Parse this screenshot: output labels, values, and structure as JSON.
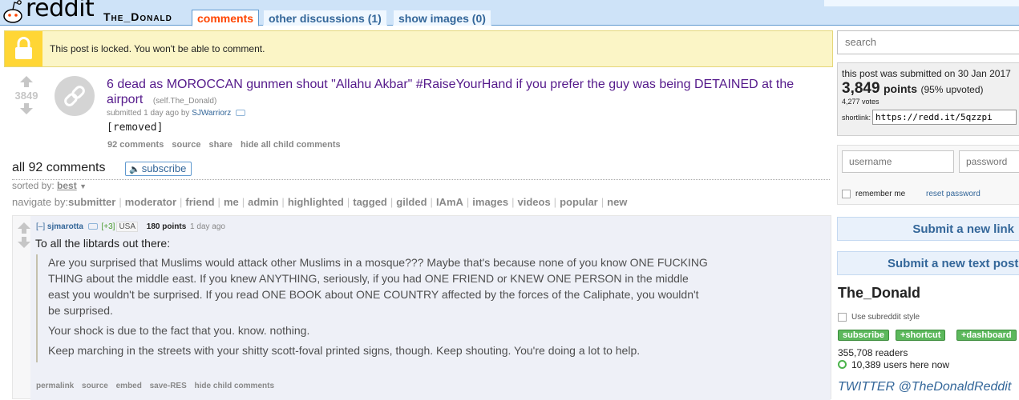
{
  "header": {
    "logo_text": "reddit",
    "subreddit": "The_Donald",
    "tabs": [
      {
        "label": "comments"
      },
      {
        "label": "other discussions (1)"
      },
      {
        "label": "show images (0)"
      }
    ]
  },
  "locked_banner": {
    "text": "This post is locked. You won't be able to comment."
  },
  "post": {
    "score": "3849",
    "title": "6 dead as MOROCCAN gunmen shout \"Allahu Akbar\" #RaiseYourHand if you prefer the guy was being DETAINED at the airport",
    "domain": "(self.The_Donald)",
    "tagline_prefix": "submitted 1 day ago by",
    "author": "SJWarriorz",
    "body": "[removed]",
    "buttons": [
      "92 comments",
      "source",
      "share",
      "hide all child comments"
    ]
  },
  "comments_header": {
    "all_comments": "all 92 comments",
    "subscribe": "subscribe",
    "sorted_by_label": "sorted by:",
    "sorted_by_value": "best",
    "navigate_label": "navigate by:",
    "navigate_items": [
      "submitter",
      "moderator",
      "friend",
      "me",
      "admin",
      "highlighted",
      "tagged",
      "gilded",
      "IAmA",
      "images",
      "videos",
      "popular",
      "new"
    ]
  },
  "comment": {
    "expand": "[–]",
    "author": "sjmarotta",
    "flair_score": "[+3]",
    "flair": "USA",
    "points": "180 points",
    "time": "1 day ago",
    "intro": "To all the libtards out there:",
    "quote_paragraphs": [
      "Are you surprised that Muslims would attack other Muslims in a mosque??? Maybe that's because none of you know ONE FUCKING THING about the middle east. If you knew ANYTHING, seriously, if you had ONE FRIEND or KNEW ONE PERSON in the middle east you wouldn't be surprised. If you read ONE BOOK about ONE COUNTRY affected by the forces of the Caliphate, you wouldn't be surprised.",
      "Your shock is due to the fact that you. know. nothing.",
      "Keep marching in the streets with your shitty scott-foval printed signs, though. Keep shouting. You're doing a lot to help."
    ],
    "buttons": [
      "permalink",
      "source",
      "embed",
      "save-RES",
      "hide child comments"
    ]
  },
  "sidebar": {
    "search_placeholder": "search",
    "submitted_prefix": "this post was submitted on",
    "submitted_date": "30 Jan 2017",
    "points_num": "3,849",
    "points_word": "points",
    "upvoted": "(95% upvoted)",
    "votes": "4,277 votes",
    "shortlink_label": "shortlink:",
    "shortlink_value": "https://redd.it/5qzzpi",
    "username_placeholder": "username",
    "password_placeholder": "password",
    "remember_me": "remember me",
    "reset_password": "reset password",
    "submit_link": "Submit a new link",
    "submit_text": "Submit a new text post",
    "subreddit_title": "The_Donald",
    "use_style": "Use subreddit style",
    "sr_buttons": [
      "subscribe",
      "+shortcut",
      "+dashboard"
    ],
    "readers": "355,708 readers",
    "users_here": "10,389 users here now",
    "twitter": "TWITTER @TheDonaldReddit"
  },
  "colors": {
    "header_bg": "#cee3f8",
    "lock_yellow": "#ffd635",
    "visited_title": "#551a8b",
    "link_blue": "#336699",
    "selected_tab": "#ff4500",
    "subscribe_green": "#5cb85c"
  },
  "icons": [
    "reddit-alien-icon",
    "lock-icon",
    "upvote-arrow-icon",
    "downvote-arrow-icon",
    "link-thumbnail-icon",
    "speaker-icon",
    "dropdown-caret-icon",
    "online-dot-icon"
  ]
}
